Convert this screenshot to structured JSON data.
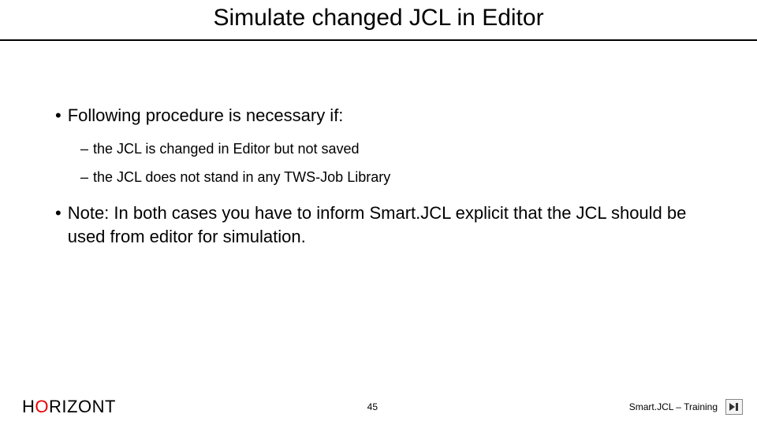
{
  "title": "Simulate changed JCL in Editor",
  "bullets": {
    "b1": "Following procedure is necessary if:",
    "sub1": "the JCL is changed in Editor but not saved",
    "sub2": "the JCL does not stand in any TWS-Job Library",
    "note": "Note: In both cases you have to inform Smart.JCL explicit that the JCL should be used from editor for simulation."
  },
  "footer": {
    "brand_pre": "H",
    "brand_o": "O",
    "brand_post": "RIZONT",
    "page": "45",
    "right_text": "Smart.JCL – Training"
  },
  "markers": {
    "dot": "•",
    "dash": "–"
  }
}
